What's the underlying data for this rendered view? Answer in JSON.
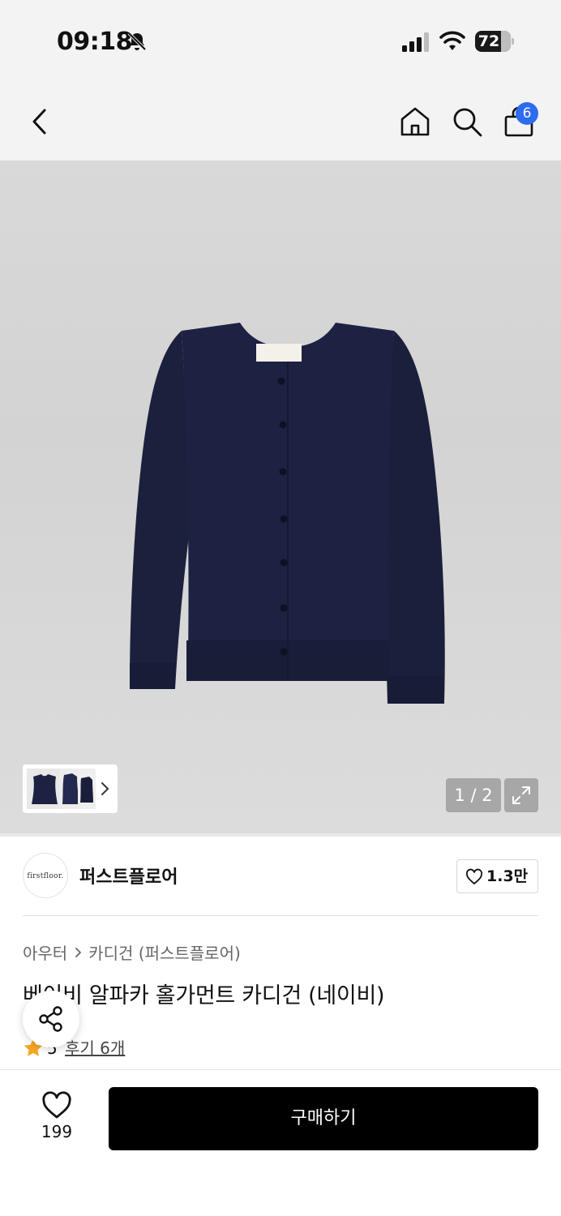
{
  "status_bar": {
    "time": "09:18",
    "battery_level": "72",
    "icons": [
      "bell-slash-icon",
      "cellular-signal-icon",
      "wifi-icon",
      "battery-icon"
    ]
  },
  "nav": {
    "icons": [
      "back-icon",
      "home-icon",
      "search-icon",
      "shopping-bag-icon"
    ],
    "cart_badge_count": "6"
  },
  "gallery": {
    "page_counter": "1 / 2",
    "current_image": 1,
    "total_images": 2,
    "expand_icon": "expand-icon",
    "thumbnail_more_icon": "chevron-right-icon"
  },
  "brand": {
    "logo_text": "firstfloor.",
    "name": "퍼스트플로어",
    "follow_count": "1.3만"
  },
  "breadcrumb": {
    "items": [
      "아우터",
      "카디건 (퍼스트플로어)"
    ]
  },
  "product": {
    "title": "베이비 알파카 홀가먼트 카디건 (네이비)",
    "rating": "5",
    "review_link": "후기 6개"
  },
  "bottom_bar": {
    "wish_count": "199",
    "buy_label": "구매하기"
  },
  "colors": {
    "background": "#ffffff",
    "header_background": "#f3f3f3",
    "badge_blue": "#2d6cf0",
    "buy_button": "#000000",
    "star": "#f5a623",
    "product_navy": "#1c2140"
  }
}
